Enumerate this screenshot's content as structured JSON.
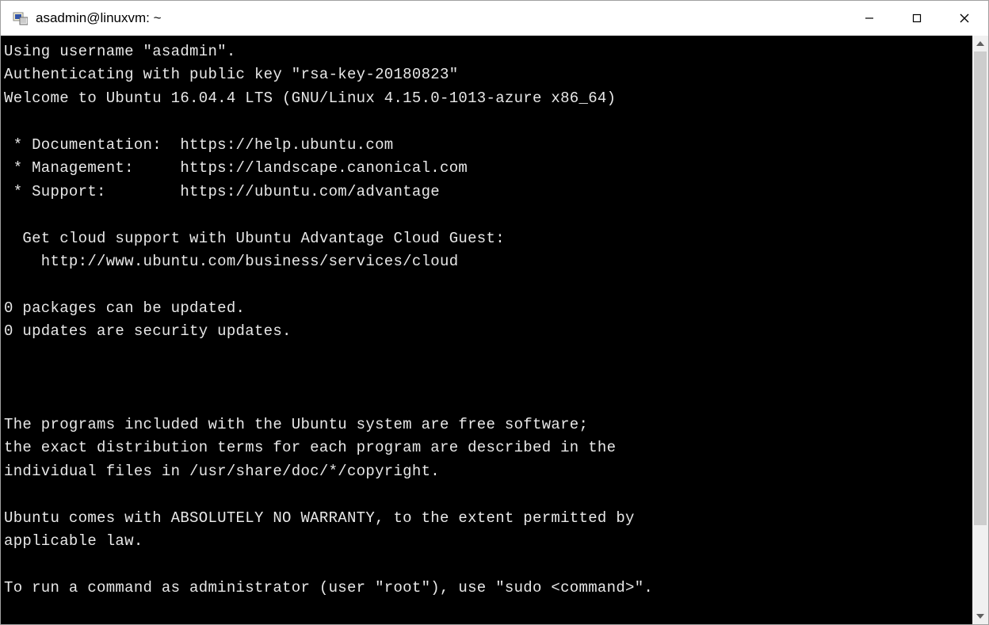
{
  "window": {
    "title": "asadmin@linuxvm: ~"
  },
  "terminal": {
    "lines": [
      "Using username \"asadmin\".",
      "Authenticating with public key \"rsa-key-20180823\"",
      "Welcome to Ubuntu 16.04.4 LTS (GNU/Linux 4.15.0-1013-azure x86_64)",
      "",
      " * Documentation:  https://help.ubuntu.com",
      " * Management:     https://landscape.canonical.com",
      " * Support:        https://ubuntu.com/advantage",
      "",
      "  Get cloud support with Ubuntu Advantage Cloud Guest:",
      "    http://www.ubuntu.com/business/services/cloud",
      "",
      "0 packages can be updated.",
      "0 updates are security updates.",
      "",
      "",
      "",
      "The programs included with the Ubuntu system are free software;",
      "the exact distribution terms for each program are described in the",
      "individual files in /usr/share/doc/*/copyright.",
      "",
      "Ubuntu comes with ABSOLUTELY NO WARRANTY, to the extent permitted by",
      "applicable law.",
      "",
      "To run a command as administrator (user \"root\"), use \"sudo <command>\"."
    ]
  }
}
